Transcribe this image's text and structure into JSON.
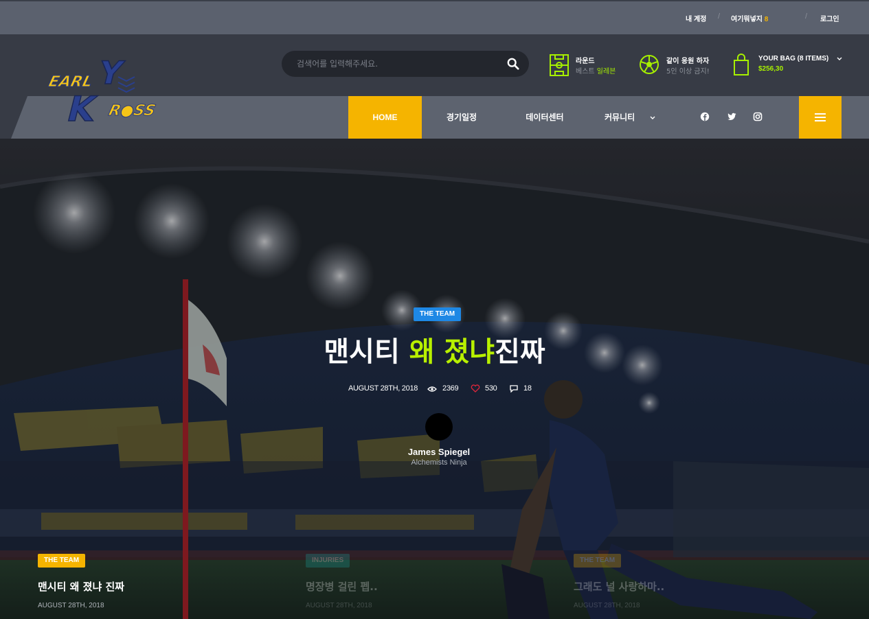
{
  "topbar": {
    "my_account": "내 계정",
    "wishlist_label": "여기뭐넣지",
    "wishlist_count": "8",
    "login": "로그인"
  },
  "search": {
    "placeholder": "검색어를 입력해주세요."
  },
  "header_info": [
    {
      "title": "라운드",
      "sub_prefix": "베스트 ",
      "sub_highlight": "일레븐",
      "icon": "field-icon"
    },
    {
      "title": "같이 응원 하자",
      "sub": "5인 이상 금지!",
      "icon": "soccer-ball-icon"
    },
    {
      "title": "YOUR BAG (8 ITEMS)",
      "sub": "$256,30",
      "icon": "shopping-bag-icon"
    }
  ],
  "logo": {
    "line1": "EARLY",
    "line2": "KROSS"
  },
  "nav": {
    "items": [
      {
        "label": "HOME"
      },
      {
        "label": "경기일정"
      },
      {
        "label": "데이터센터"
      },
      {
        "label": "커뮤니티"
      }
    ],
    "social": [
      "facebook-icon",
      "twitter-icon",
      "instagram-icon"
    ]
  },
  "hero": {
    "category": "THE TEAM",
    "title_part1": "맨시티 ",
    "title_highlight": "왜 졌냐",
    "title_part2": "진짜",
    "date": "AUGUST 28TH, 2018",
    "views": "2369",
    "likes": "530",
    "comments": "18",
    "author_name": "James Spiegel",
    "author_role": "Alchemists Ninja"
  },
  "cards": [
    {
      "category": "THE TEAM",
      "title": "맨시티 왜 졌냐 진짜",
      "date": "AUGUST 28TH, 2018",
      "color": "#f5b400"
    },
    {
      "category": "INJURIES",
      "title": "명장병 걸린 펩..",
      "date": "AUGUST 28TH, 2018",
      "color": "#1aa6a0"
    },
    {
      "category": "THE TEAM",
      "title": "그래도 널 사랑하마..",
      "date": "AUGUST 28TH, 2018",
      "color": "#f5b400"
    }
  ],
  "colors": {
    "accent": "#f5b400",
    "highlight": "#b8f000",
    "badge_blue": "#1e88e5"
  }
}
